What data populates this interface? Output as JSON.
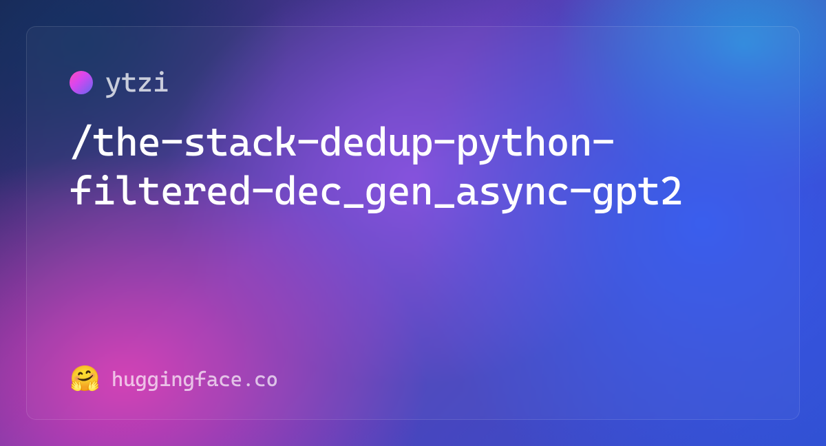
{
  "owner": {
    "name": "ytzi"
  },
  "repo": {
    "path": "/the-stack-dedup-python-filtered-dec_gen_async-gpt2"
  },
  "footer": {
    "site": "huggingface.co",
    "emoji": "🤗"
  }
}
